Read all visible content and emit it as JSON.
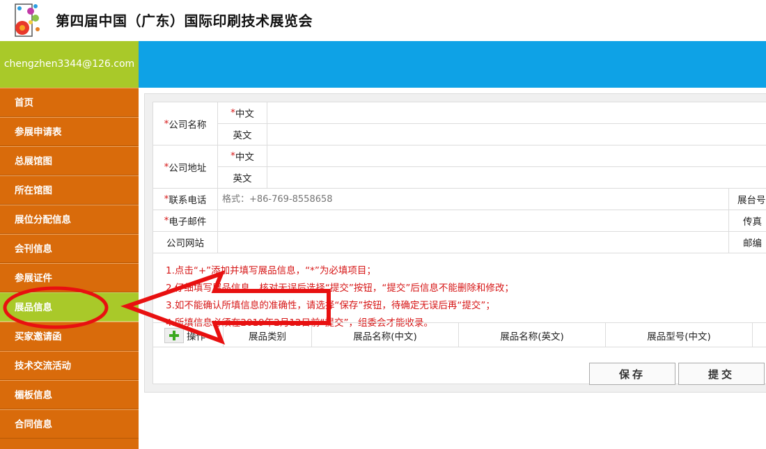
{
  "header": {
    "title": "第四届中国（广东）国际印刷技术展览会"
  },
  "user": {
    "email": "chengzhen3344@126.com"
  },
  "sidebar": {
    "items": [
      {
        "label": "首页"
      },
      {
        "label": "参展申请表"
      },
      {
        "label": "总展馆图"
      },
      {
        "label": "所在馆图"
      },
      {
        "label": "展位分配信息"
      },
      {
        "label": "会刊信息"
      },
      {
        "label": "参展证件"
      },
      {
        "label": "展品信息",
        "active": true
      },
      {
        "label": "买家邀请函"
      },
      {
        "label": "技术交流活动"
      },
      {
        "label": "楣板信息"
      },
      {
        "label": "合同信息"
      }
    ]
  },
  "form": {
    "company_name_label": "公司名称",
    "company_address_label": "公司地址",
    "chinese_label": "中文",
    "english_label": "英文",
    "phone_label": "联系电话",
    "phone_placeholder": "格式：+86-769-8558658",
    "booth_label": "展台号",
    "email_label": "电子邮件",
    "fax_label": "传真",
    "website_label": "公司网站",
    "zip_label": "邮编",
    "required_mark": "*"
  },
  "notes": [
    "1.点击“+”添加并填写展品信息，“*”为必填项目；",
    "2.仔细填写展品信息，核对无误后选择“提交”按钮，“提交”后信息不能删除和修改；",
    "3.如不能确认所填信息的准确性，请选择“保存”按钮，待确定无误后再“提交”；",
    "4.所填信息必须在2019年2月12日前“提交”，组委会才能收录。"
  ],
  "grid": {
    "columns": [
      "操作",
      "展品类别",
      "展品名称(中文)",
      "展品名称(英文)",
      "展品型号(中文)"
    ]
  },
  "buttons": {
    "save": "保存",
    "submit": "提交"
  },
  "colors": {
    "sidebar": "#d96b0b",
    "accent_green": "#a9c929",
    "header_blue": "#0ea2e6",
    "annotation_red": "#e81010"
  },
  "icons": {
    "plus": "plus-icon"
  }
}
